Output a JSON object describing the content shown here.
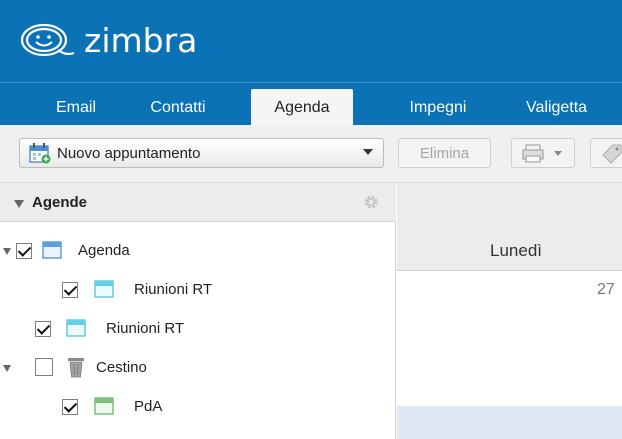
{
  "app": {
    "name": "zimbra"
  },
  "tabs": [
    {
      "label": "Email",
      "active": false
    },
    {
      "label": "Contatti",
      "active": false
    },
    {
      "label": "Agenda",
      "active": true
    },
    {
      "label": "Impegni",
      "active": false
    },
    {
      "label": "Valigetta",
      "active": false
    }
  ],
  "toolbar": {
    "new_appointment_label": "Nuovo appuntamento",
    "new_appointment_icon": "calendar-add-icon",
    "delete_label": "Elimina",
    "print_icon": "print-icon",
    "tag_icon": "tag-icon"
  },
  "sidebar": {
    "title": "Agende",
    "settings_icon": "gear-icon",
    "items": [
      {
        "label": "Agenda",
        "checked": true,
        "expanded": true,
        "icon": "calendar-icon",
        "color": "#5aa0dd"
      },
      {
        "label": "Riunioni RT",
        "checked": true,
        "icon": "calendar-icon",
        "color": "#62d0e6"
      },
      {
        "label": "Riunioni RT",
        "checked": true,
        "icon": "calendar-icon",
        "color": "#62d0e6"
      },
      {
        "label": "Cestino",
        "checked": false,
        "expanded": true,
        "icon": "trash-icon"
      },
      {
        "label": "PdA",
        "checked": true,
        "icon": "calendar-icon",
        "color": "#7cc27c"
      }
    ]
  },
  "calendar": {
    "day_name": "Lunedì",
    "day_number": "27"
  },
  "colors": {
    "brand": "#0a72b5",
    "toolbar_bg": "#efefef"
  }
}
